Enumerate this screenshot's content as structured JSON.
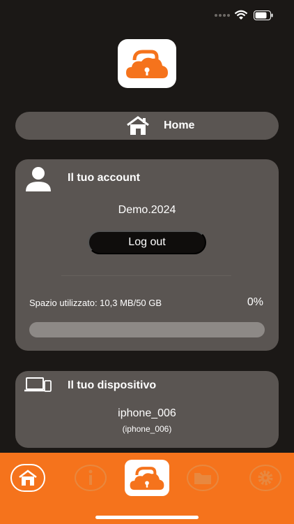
{
  "home": {
    "label": "Home"
  },
  "account": {
    "title": "Il tuo account",
    "username": "Demo.2024",
    "logout_label": "Log out",
    "storage_label": "Spazio utilizzato: 10,3 MB/50 GB",
    "storage_percent": "0%",
    "storage_fraction": 0
  },
  "device": {
    "title": "Il tuo dispositivo",
    "name": "iphone_006",
    "subname": "(iphone_006)"
  },
  "nav": {
    "items": [
      "home-icon",
      "info-icon",
      "cloud-lock-icon",
      "folder-icon",
      "gear-icon"
    ]
  },
  "colors": {
    "background": "#1b1816",
    "card": "#5a5552",
    "accent": "#f5731c"
  }
}
